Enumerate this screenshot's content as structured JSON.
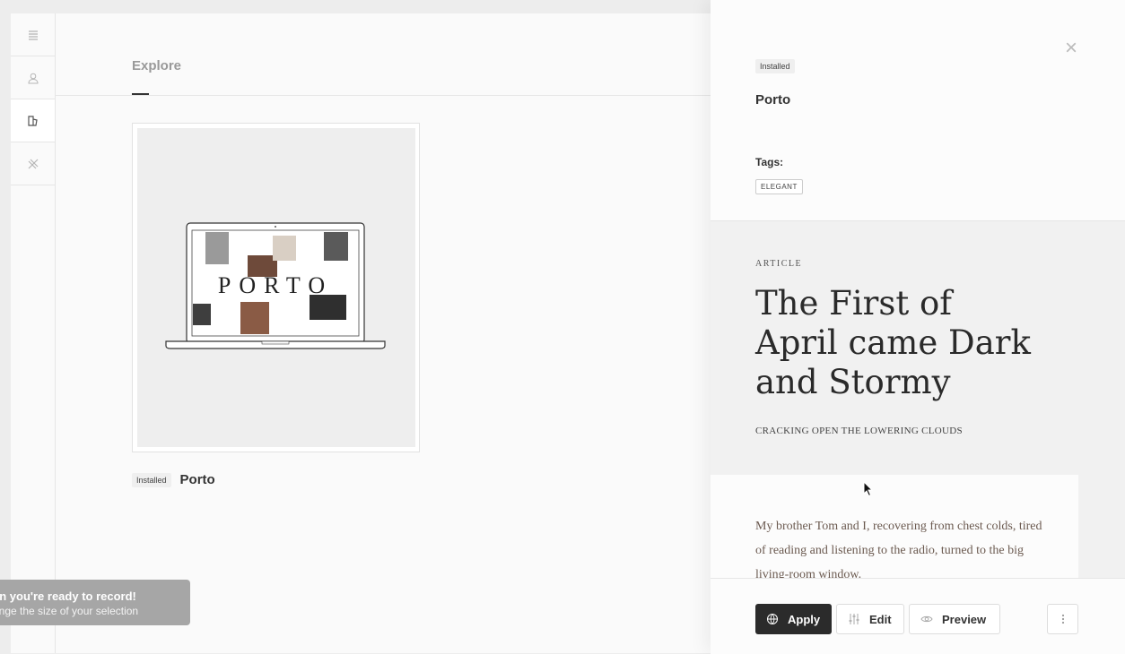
{
  "app": {
    "rail": [
      {
        "name": "menu-icon"
      },
      {
        "name": "user-icon"
      },
      {
        "name": "themes-icon"
      },
      {
        "name": "tools-icon"
      }
    ],
    "tab_label": "Explore",
    "card": {
      "badge": "Installed",
      "title": "Porto",
      "thumb_text": "PORTO"
    }
  },
  "toast": {
    "line1": "en you're ready to record!",
    "line2": "ange the size of your selection"
  },
  "panel": {
    "badge": "Installed",
    "title": "Porto",
    "tags_label": "Tags:",
    "tags": [
      "ELEGANT"
    ],
    "preview": {
      "kicker": "ARTICLE",
      "heading": "The First of April came Dark and Stormy",
      "subheading": "CRACKING OPEN THE LOWERING CLOUDS",
      "body": "My brother Tom and I, recovering from chest colds, tired of reading and listening to the radio, turned to the big living-room window."
    },
    "actions": {
      "apply": "Apply",
      "edit": "Edit",
      "preview": "Preview"
    }
  }
}
